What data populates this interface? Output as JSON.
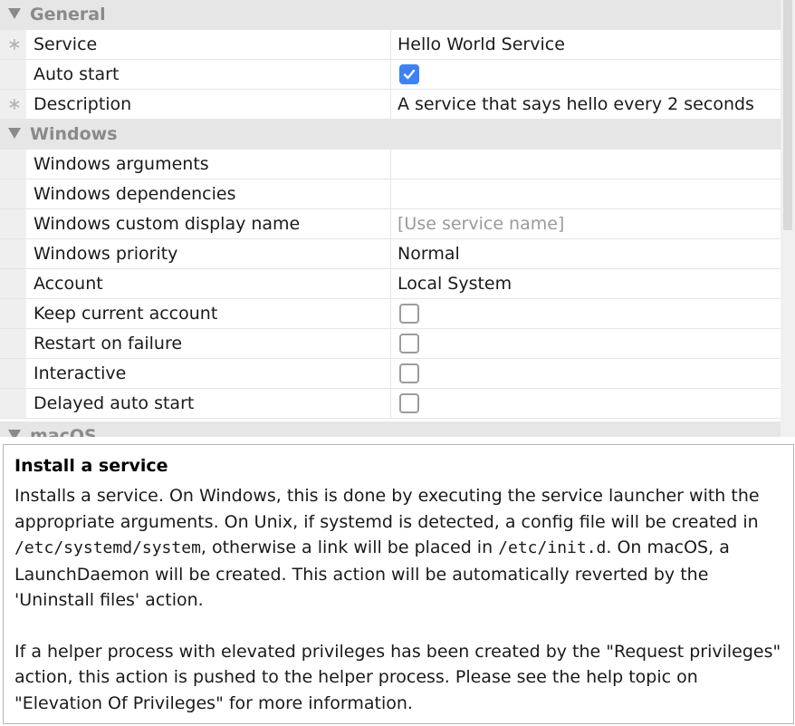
{
  "sections": {
    "general": "General",
    "windows": "Windows",
    "macos_partial": "macOS"
  },
  "general": {
    "service_label": "Service",
    "service_value": "Hello World Service",
    "autostart_label": "Auto start",
    "autostart_checked": true,
    "description_label": "Description",
    "description_value": "A service that says hello every 2 seconds",
    "required_marker": "∗"
  },
  "windows": {
    "arguments_label": "Windows arguments",
    "arguments_value": "",
    "dependencies_label": "Windows dependencies",
    "dependencies_value": "",
    "custom_display_name_label": "Windows custom display name",
    "custom_display_name_placeholder": "[Use service name]",
    "priority_label": "Windows priority",
    "priority_value": "Normal",
    "account_label": "Account",
    "account_value": "Local System",
    "keep_account_label": "Keep current account",
    "keep_account_checked": false,
    "restart_label": "Restart on failure",
    "restart_checked": false,
    "interactive_label": "Interactive",
    "interactive_checked": false,
    "delayed_label": "Delayed auto start",
    "delayed_checked": false
  },
  "help": {
    "title": "Install a service",
    "p1_a": "Installs a service. On Windows, this is done by executing the service launcher with the appropriate arguments. On Unix, if systemd is detected, a config file will be created in ",
    "p1_path1": "/etc/systemd/system",
    "p1_b": ", otherwise a link will be placed in ",
    "p1_path2": "/etc/init.d",
    "p1_c": ". On macOS, a LaunchDaemon will be created. This action will be automatically reverted by the 'Uninstall files' action.",
    "p2": "If a helper process with elevated privileges has been created by the \"Request privileges\" action, this action is pushed to the helper process. Please see the help topic on \"Elevation Of Privileges\" for more information."
  },
  "colors": {
    "accent": "#3b82f6",
    "section_bg": "#e6e6e6",
    "section_text": "#8a8a8a"
  }
}
